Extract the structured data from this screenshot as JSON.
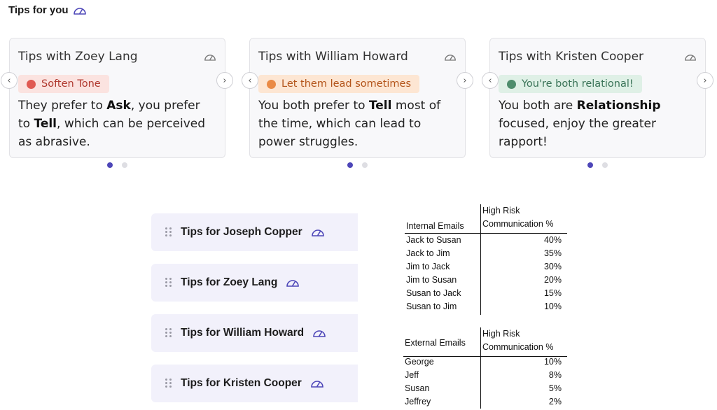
{
  "header": {
    "title": "Tips for you",
    "icon": "gauge-icon"
  },
  "cards": [
    {
      "title": "Tips with Zoey Lang",
      "badge": {
        "label": "Soften Tone",
        "bg": "#fbe3e0",
        "dot": "#e05a52",
        "color": "#b0392f"
      },
      "body": [
        {
          "t": "They prefer to ",
          "b": false
        },
        {
          "t": "Ask",
          "b": true
        },
        {
          "t": ", you prefer to ",
          "b": false
        },
        {
          "t": "Tell",
          "b": true
        },
        {
          "t": ", which can be perceived as abrasive.",
          "b": false
        }
      ],
      "prev": "‹",
      "next": "›"
    },
    {
      "title": "Tips with William Howard",
      "badge": {
        "label": "Let them lead sometimes",
        "bg": "#fde6d3",
        "dot": "#ea8a45",
        "color": "#b3541a"
      },
      "body": [
        {
          "t": "You both prefer to ",
          "b": false
        },
        {
          "t": "Tell",
          "b": true
        },
        {
          "t": " most of the time, which can lead to power struggles.",
          "b": false
        }
      ],
      "prev": "‹",
      "next": "›"
    },
    {
      "title": "Tips with Kristen Cooper",
      "badge": {
        "label": "You're both relational!",
        "bg": "#dff0e6",
        "dot": "#4e8d6c",
        "color": "#3a7458"
      },
      "body": [
        {
          "t": "You both are ",
          "b": false
        },
        {
          "t": "Relationship",
          "b": true
        },
        {
          "t": " focused, enjoy the greater rapport!",
          "b": false
        }
      ],
      "prev": "‹",
      "next": "›"
    }
  ],
  "tips_list": [
    {
      "label": "Tips for Joseph Copper"
    },
    {
      "label": "Tips for Zoey Lang"
    },
    {
      "label": "Tips for William Howard"
    },
    {
      "label": "Tips for Kristen Cooper"
    }
  ],
  "internal_table": {
    "col1": "Internal Emails",
    "col2_line1": "High Risk",
    "col2_line2": "Communication %",
    "rows": [
      {
        "k": "Jack to Susan",
        "v": "40%"
      },
      {
        "k": "Jack to Jim",
        "v": "35%"
      },
      {
        "k": "Jim to Jack",
        "v": "30%"
      },
      {
        "k": "Jim to Susan",
        "v": "20%"
      },
      {
        "k": "Susan to Jack",
        "v": "15%"
      },
      {
        "k": "Susan to Jim",
        "v": "10%"
      }
    ]
  },
  "external_table": {
    "col1": "External Emails",
    "col2_line1": "High Risk",
    "col2_line2": "Communication %",
    "rows": [
      {
        "k": "George",
        "v": "10%"
      },
      {
        "k": "Jeff",
        "v": "8%"
      },
      {
        "k": "Susan",
        "v": "5%"
      },
      {
        "k": "Jeffrey",
        "v": "2%"
      }
    ]
  },
  "colors": {
    "accent": "#4d46b8",
    "row_bg": "#f2f1fb"
  }
}
